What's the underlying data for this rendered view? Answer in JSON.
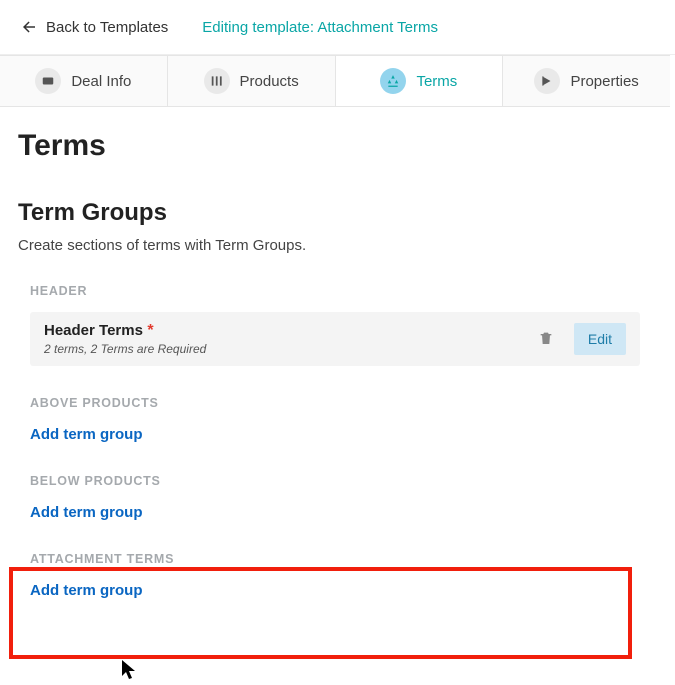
{
  "topbar": {
    "back_label": "Back to Templates",
    "editing_label": "Editing template: Attachment Terms"
  },
  "tabs": {
    "dealinfo": "Deal Info",
    "products": "Products",
    "terms": "Terms",
    "properties": "Properties"
  },
  "page": {
    "title": "Terms",
    "term_groups_title": "Term Groups",
    "term_groups_desc": "Create sections of terms with Term Groups."
  },
  "sections": {
    "header_label": "HEADER",
    "header_card": {
      "title": "Header Terms",
      "sub": "2 terms, 2 Terms are Required",
      "edit": "Edit"
    },
    "above_label": "ABOVE PRODUCTS",
    "below_label": "BELOW PRODUCTS",
    "attachment_label": "ATTACHMENT TERMS",
    "add_link": "Add term group"
  }
}
